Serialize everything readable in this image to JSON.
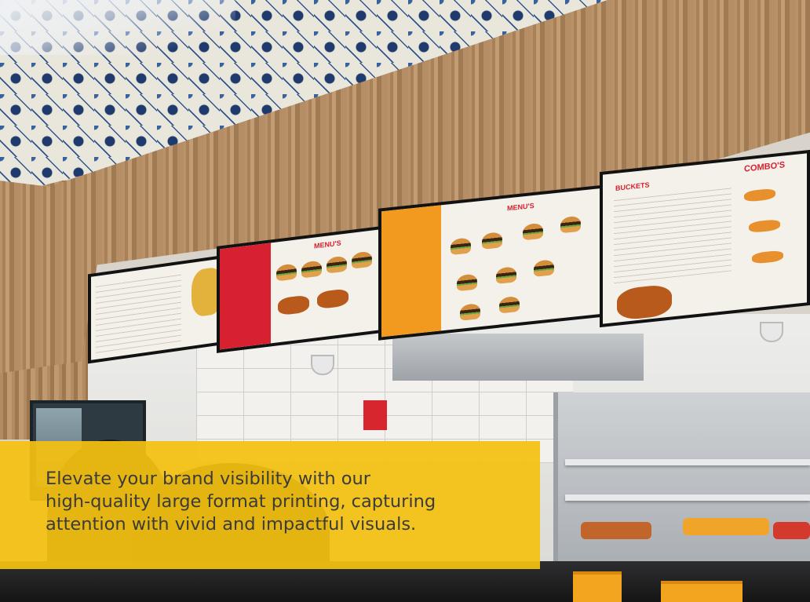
{
  "caption": {
    "line1": "Elevate your brand visibility with our",
    "line2": "high-quality large format printing, capturing",
    "line3": "attention with vivid and impactful visuals."
  },
  "menu_boards": {
    "screen2_title": "MENU'S",
    "screen3_title": "MENU'S",
    "screen4_title": "COMBO'S",
    "screen4_subtitle": "BUCKETS"
  },
  "colors": {
    "caption_bg": "#f4c111",
    "caption_text": "#3b3b3b",
    "brand_red": "#d72030",
    "brand_orange": "#f29a1f"
  }
}
